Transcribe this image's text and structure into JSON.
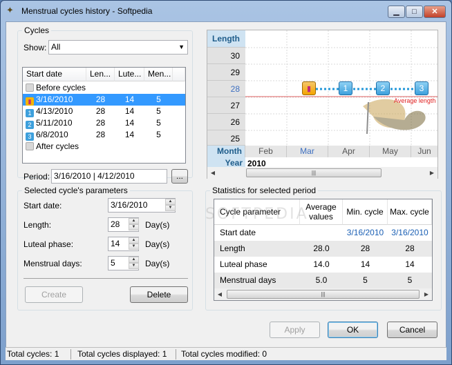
{
  "window": {
    "title": "Menstrual cycles history - Softpedia",
    "min_glyph": "▁",
    "max_glyph": "□",
    "close_glyph": "✕",
    "app_icon": "butterfly-icon"
  },
  "cycles_group": {
    "title": "Cycles",
    "show_label": "Show:",
    "show_value": "All",
    "columns": [
      "Start date",
      "Len...",
      "Lute...",
      "Men..."
    ],
    "before_label": "Before cycles",
    "after_label": "After cycles",
    "rows": [
      {
        "badge": "",
        "start": "3/16/2010",
        "length": "28",
        "luteal": "14",
        "menstrual": "5"
      },
      {
        "badge": "1",
        "start": "4/13/2010",
        "length": "28",
        "luteal": "14",
        "menstrual": "5"
      },
      {
        "badge": "2",
        "start": "5/11/2010",
        "length": "28",
        "luteal": "14",
        "menstrual": "5"
      },
      {
        "badge": "3",
        "start": "6/8/2010",
        "length": "28",
        "luteal": "14",
        "menstrual": "5"
      }
    ],
    "selected_row": 0,
    "period_label": "Period:",
    "period_value": "3/16/2010 | 4/12/2010",
    "browse_label": "..."
  },
  "params_group": {
    "title": "Selected cycle's parameters",
    "start_label": "Start date:",
    "start_value": "3/16/2010",
    "length_label": "Length:",
    "length_value": "28",
    "luteal_label": "Luteal phase:",
    "luteal_value": "14",
    "menstrual_label": "Menstrual days:",
    "menstrual_value": "5",
    "unit": "Day(s)",
    "create_label": "Create",
    "delete_label": "Delete"
  },
  "chart": {
    "length_header": "Length",
    "month_header": "Month",
    "year_header": "Year",
    "year_value": "2010",
    "y_ticks": [
      "30",
      "29",
      "28",
      "27",
      "26",
      "25"
    ],
    "highlight_tick": "28",
    "months": [
      "Feb",
      "Mar",
      "Apr",
      "May",
      "Jun"
    ],
    "highlight_month": "Mar",
    "nodes": [
      "",
      "1",
      "2",
      "3"
    ],
    "avg_label": "Average length",
    "accent": "#2196d8",
    "avg_color": "#e02020"
  },
  "stats_group": {
    "title": "Statistics for selected period",
    "columns": [
      "Cycle parameter",
      "Average values",
      "Min. cycle",
      "Max. cycle"
    ],
    "rows": [
      {
        "param": "Start date",
        "avg": "",
        "min": "3/16/2010",
        "max": "3/16/2010",
        "link": true
      },
      {
        "param": "Length",
        "avg": "28.0",
        "min": "28",
        "max": "28"
      },
      {
        "param": "Luteal phase",
        "avg": "14.0",
        "min": "14",
        "max": "14"
      },
      {
        "param": "Menstrual days",
        "avg": "5.0",
        "min": "5",
        "max": "5"
      }
    ]
  },
  "buttons": {
    "apply": "Apply",
    "ok": "OK",
    "cancel": "Cancel"
  },
  "status": {
    "total": "Total cycles: 1",
    "displayed": "Total cycles displayed: 1",
    "modified": "Total cycles modified: 0"
  },
  "watermark": "SOFTPEDIA"
}
